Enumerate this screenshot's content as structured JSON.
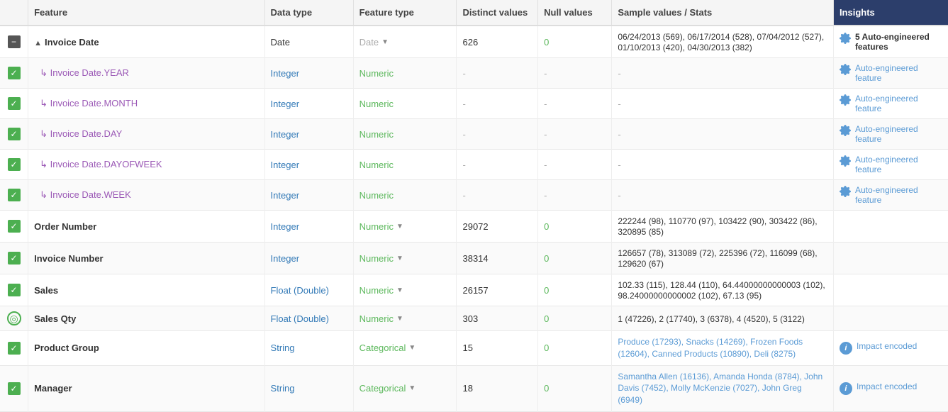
{
  "table": {
    "headers": {
      "checkbox": "",
      "feature": "Feature",
      "datatype": "Data type",
      "featuretype": "Feature type",
      "distinct": "Distinct values",
      "null": "Null values",
      "sample": "Sample values / Stats",
      "insights": "Insights"
    },
    "rows": [
      {
        "id": "invoice-date",
        "checkboxType": "minus",
        "featureName": "Invoice Date",
        "hasCollapse": true,
        "isParent": true,
        "datatype": "Date",
        "datatypeClass": "dtype-date",
        "featuretype": "Date",
        "featuretypeClass": "ftype-date",
        "hasDropdown": true,
        "distinct": "626",
        "nullVal": "0",
        "nullClass": "null-val-zero",
        "sample": "06/24/2013 (569), 06/17/2014 (528), 07/04/2012 (527), 01/10/2013 (420), 04/30/2013 (382)",
        "sampleClass": "sample-black",
        "insightsType": "bold",
        "insightsText": "5 Auto-engineered features",
        "hasGearIcon": true
      },
      {
        "id": "invoice-date-year",
        "checkboxType": "check",
        "featureName": "↳ Invoice Date.YEAR",
        "isChild": true,
        "datatype": "Integer",
        "datatypeClass": "dtype-integer",
        "featuretype": "Numeric",
        "featuretypeClass": "ftype-numeric",
        "hasDropdown": false,
        "distinct": "-",
        "distinctClass": "dash",
        "nullVal": "-",
        "nullClass": "dash",
        "sample": "-",
        "sampleClass": "dash",
        "insightsType": "auto",
        "insightsText": "Auto-engineered feature",
        "hasGearIcon": true
      },
      {
        "id": "invoice-date-month",
        "checkboxType": "check",
        "featureName": "↳ Invoice Date.MONTH",
        "isChild": true,
        "datatype": "Integer",
        "datatypeClass": "dtype-integer",
        "featuretype": "Numeric",
        "featuretypeClass": "ftype-numeric",
        "hasDropdown": false,
        "distinct": "-",
        "distinctClass": "dash",
        "nullVal": "-",
        "nullClass": "dash",
        "sample": "-",
        "sampleClass": "dash",
        "insightsType": "auto",
        "insightsText": "Auto-engineered feature",
        "hasGearIcon": true
      },
      {
        "id": "invoice-date-day",
        "checkboxType": "check",
        "featureName": "↳ Invoice Date.DAY",
        "isChild": true,
        "datatype": "Integer",
        "datatypeClass": "dtype-integer",
        "featuretype": "Numeric",
        "featuretypeClass": "ftype-numeric",
        "hasDropdown": false,
        "distinct": "-",
        "distinctClass": "dash",
        "nullVal": "-",
        "nullClass": "dash",
        "sample": "-",
        "sampleClass": "dash",
        "insightsType": "auto",
        "insightsText": "Auto-engineered feature",
        "hasGearIcon": true
      },
      {
        "id": "invoice-date-dayofweek",
        "checkboxType": "check",
        "featureName": "↳ Invoice Date.DAYOFWEEK",
        "isChild": true,
        "datatype": "Integer",
        "datatypeClass": "dtype-integer",
        "featuretype": "Numeric",
        "featuretypeClass": "ftype-numeric",
        "hasDropdown": false,
        "distinct": "-",
        "distinctClass": "dash",
        "nullVal": "-",
        "nullClass": "dash",
        "sample": "-",
        "sampleClass": "dash",
        "insightsType": "auto",
        "insightsText": "Auto-engineered feature",
        "hasGearIcon": true
      },
      {
        "id": "invoice-date-week",
        "checkboxType": "check",
        "featureName": "↳ Invoice Date.WEEK",
        "isChild": true,
        "datatype": "Integer",
        "datatypeClass": "dtype-integer",
        "featuretype": "Numeric",
        "featuretypeClass": "ftype-numeric",
        "hasDropdown": false,
        "distinct": "-",
        "distinctClass": "dash",
        "nullVal": "-",
        "nullClass": "dash",
        "sample": "-",
        "sampleClass": "dash",
        "insightsType": "auto",
        "insightsText": "Auto-engineered feature",
        "hasGearIcon": true
      },
      {
        "id": "order-number",
        "checkboxType": "check",
        "featureName": "Order Number",
        "isParent": true,
        "datatype": "Integer",
        "datatypeClass": "dtype-integer",
        "featuretype": "Numeric",
        "featuretypeClass": "ftype-numeric",
        "hasDropdown": true,
        "distinct": "29072",
        "nullVal": "0",
        "nullClass": "null-val-zero",
        "sample": "222244 (98), 110770 (97), 103422 (90), 303422 (86), 320895 (85)",
        "sampleClass": "sample-black",
        "insightsType": "none",
        "insightsText": ""
      },
      {
        "id": "invoice-number",
        "checkboxType": "check",
        "featureName": "Invoice Number",
        "isParent": true,
        "datatype": "Integer",
        "datatypeClass": "dtype-integer",
        "featuretype": "Numeric",
        "featuretypeClass": "ftype-numeric",
        "hasDropdown": true,
        "distinct": "38314",
        "nullVal": "0",
        "nullClass": "null-val-zero",
        "sample": "126657 (78), 313089 (72), 225396 (72), 116099 (68), 129620 (67)",
        "sampleClass": "sample-black",
        "insightsType": "none",
        "insightsText": ""
      },
      {
        "id": "sales",
        "checkboxType": "check",
        "featureName": "Sales",
        "isParent": true,
        "datatype": "Float (Double)",
        "datatypeClass": "dtype-float",
        "featuretype": "Numeric",
        "featuretypeClass": "ftype-numeric",
        "hasDropdown": true,
        "distinct": "26157",
        "nullVal": "0",
        "nullClass": "null-val-zero",
        "sample": "102.33 (115), 128.44 (110), 64.44000000000003 (102), 98.24000000000002 (102), 67.13 (95)",
        "sampleClass": "sample-black",
        "insightsType": "none",
        "insightsText": ""
      },
      {
        "id": "sales-qty",
        "checkboxType": "target",
        "featureName": "Sales Qty",
        "isParent": true,
        "datatype": "Float (Double)",
        "datatypeClass": "dtype-float",
        "featuretype": "Numeric",
        "featuretypeClass": "ftype-numeric",
        "hasDropdown": true,
        "distinct": "303",
        "nullVal": "0",
        "nullClass": "null-val-zero",
        "sample": "1 (47226), 2 (17740), 3 (6378), 4 (4520), 5 (3122)",
        "sampleClass": "sample-black",
        "insightsType": "none",
        "insightsText": ""
      },
      {
        "id": "product-group",
        "checkboxType": "check",
        "featureName": "Product Group",
        "isParent": true,
        "datatype": "String",
        "datatypeClass": "dtype-string",
        "featuretype": "Categorical",
        "featuretypeClass": "ftype-categorical",
        "hasDropdown": true,
        "distinct": "15",
        "nullVal": "0",
        "nullClass": "null-val-zero",
        "sample": "Produce (17293), Snacks (14269), Frozen Foods (12604), Canned Products (10890), Deli (8275)",
        "sampleClass": "sample-text",
        "insightsType": "impact",
        "insightsText": "Impact encoded"
      },
      {
        "id": "manager",
        "checkboxType": "check",
        "featureName": "Manager",
        "isParent": true,
        "datatype": "String",
        "datatypeClass": "dtype-string",
        "featuretype": "Categorical",
        "featuretypeClass": "ftype-categorical",
        "hasDropdown": true,
        "distinct": "18",
        "nullVal": "0",
        "nullClass": "null-val-zero",
        "sample": "Samantha Allen (16136), Amanda Honda (8784), John Davis (7452), Molly McKenzie (7027), John Greg (6949)",
        "sampleClass": "sample-text",
        "insightsType": "impact",
        "insightsText": "Impact encoded"
      }
    ]
  }
}
